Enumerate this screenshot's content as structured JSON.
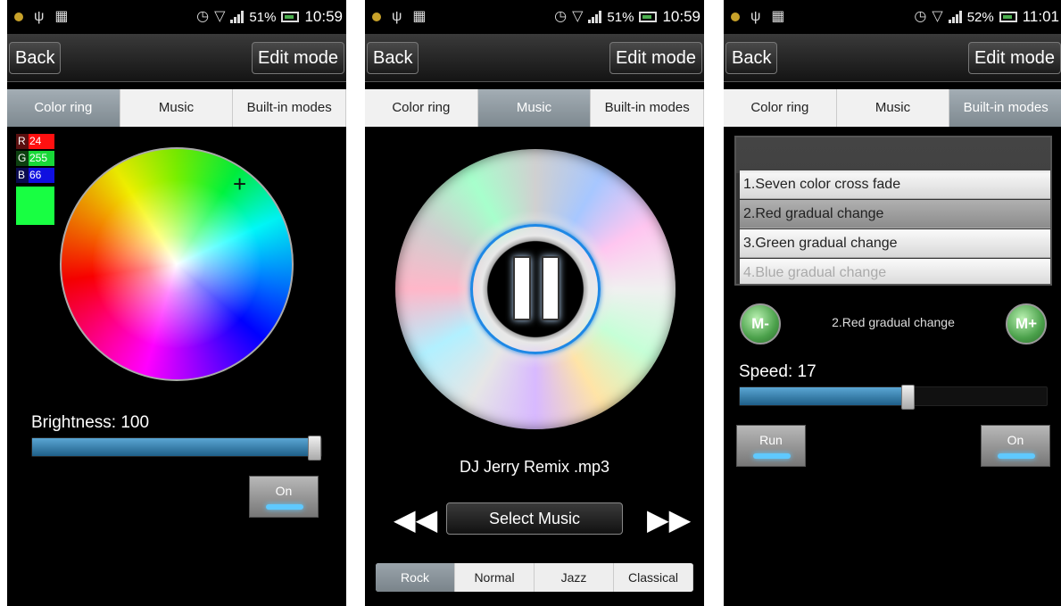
{
  "panels": [
    {
      "status": {
        "battery_pct": "51%",
        "time": "10:59"
      },
      "title": {
        "back": "Back",
        "edit": "Edit mode"
      },
      "tabs": [
        "Color ring",
        "Music",
        "Built-in modes"
      ],
      "active_tab": 0,
      "rgb": {
        "r_label": "R",
        "r": "24",
        "g_label": "G",
        "g": "255",
        "b_label": "B",
        "b": "66"
      },
      "swatch_color": "#18ff42",
      "brightness_label": "Brightness: 100",
      "brightness_level": 1.0,
      "on_label": "On"
    },
    {
      "status": {
        "battery_pct": "51%",
        "time": "10:59"
      },
      "title": {
        "back": "Back",
        "edit": "Edit mode"
      },
      "tabs": [
        "Color ring",
        "Music",
        "Built-in modes"
      ],
      "active_tab": 1,
      "track": "DJ Jerry Remix .mp3",
      "select_music": "Select Music",
      "eq": [
        "Rock",
        "Normal",
        "Jazz",
        "Classical"
      ],
      "eq_active": 0
    },
    {
      "status": {
        "battery_pct": "52%",
        "time": "11:01"
      },
      "title": {
        "back": "Back",
        "edit": "Edit mode"
      },
      "tabs": [
        "Color ring",
        "Music",
        "Built-in modes"
      ],
      "active_tab": 2,
      "modes": [
        "1.Seven color cross fade",
        "2.Red gradual change",
        "3.Green gradual change",
        "4.Blue gradual change"
      ],
      "selected_mode": 1,
      "m_minus": "M-",
      "m_plus": "M+",
      "current_mode": "2.Red gradual change",
      "speed_label": "Speed: 17",
      "speed_level": 0.55,
      "run_label": "Run",
      "on_label": "On"
    }
  ],
  "colors": {
    "accent_blue": "#1e88e5",
    "led_blue": "#5fc9ff",
    "slider_blue": "#3a86b4"
  }
}
